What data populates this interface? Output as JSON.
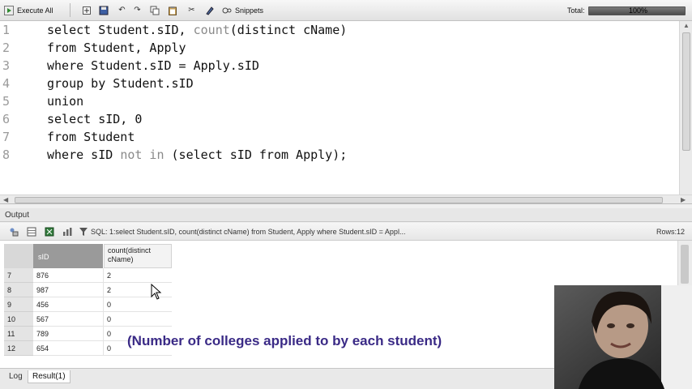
{
  "toolbar": {
    "execute_label": "Execute All",
    "snippets_label": "Snippets",
    "total_label": "Total:",
    "total_value": "100%",
    "total_progress": 1.0,
    "icons": [
      "execute-icon",
      "new-icon",
      "save-icon",
      "undo-icon",
      "redo-icon",
      "copy-icon",
      "paste-icon",
      "cut-icon",
      "format-icon",
      "find-icon",
      "snippets-icon"
    ]
  },
  "editor": {
    "line_numbers": [
      "1",
      "2",
      "3",
      "4",
      "5",
      "6",
      "7",
      "8"
    ],
    "lines": [
      {
        "before": "select Student.sID, ",
        "soft": "count",
        "after": "(distinct cName)"
      },
      {
        "before": "from Student, Apply",
        "soft": "",
        "after": ""
      },
      {
        "before": "where Student.sID = Apply.sID",
        "soft": "",
        "after": ""
      },
      {
        "before": "group by Student.sID",
        "soft": "",
        "after": ""
      },
      {
        "before": "union",
        "soft": "",
        "after": ""
      },
      {
        "before": "select sID, 0",
        "soft": "",
        "after": ""
      },
      {
        "before": "from Student",
        "soft": "",
        "after": ""
      },
      {
        "before": "where sID ",
        "soft": "not in",
        "after": " (select sID from Apply);"
      }
    ]
  },
  "output": {
    "title": "Output",
    "sql_info": "SQL: 1:select Student.sID, count(distinct cName)  from Student, Apply  where Student.sID = Appl...",
    "rows_info": "Rows:12",
    "columns": [
      "sID",
      "count(distinct\ncName)"
    ],
    "rows": [
      {
        "idx": "7",
        "sid": "876",
        "count": "2"
      },
      {
        "idx": "8",
        "sid": "987",
        "count": "2"
      },
      {
        "idx": "9",
        "sid": "456",
        "count": "0"
      },
      {
        "idx": "10",
        "sid": "567",
        "count": "0"
      },
      {
        "idx": "11",
        "sid": "789",
        "count": "0"
      },
      {
        "idx": "12",
        "sid": "654",
        "count": "0"
      }
    ]
  },
  "caption": "(Number of colleges applied to by each student)",
  "tabs": [
    {
      "label": "Log",
      "active": false
    },
    {
      "label": "Result(1)",
      "active": true
    }
  ]
}
